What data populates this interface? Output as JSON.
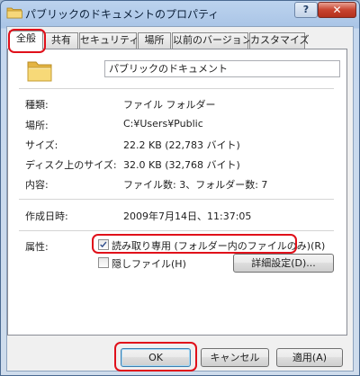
{
  "window": {
    "title": "パブリックのドキュメントのプロパティ"
  },
  "titlebar": {
    "help_label": "?",
    "close_label": "✕"
  },
  "tabs": [
    {
      "label": "全般",
      "active": true
    },
    {
      "label": "共有"
    },
    {
      "label": "セキュリティ"
    },
    {
      "label": "場所"
    },
    {
      "label": "以前のバージョン"
    },
    {
      "label": "カスタマイズ"
    }
  ],
  "general": {
    "folder_name": "パブリックのドキュメント",
    "fields": [
      {
        "label": "種類:",
        "value": "ファイル フォルダー"
      },
      {
        "label": "場所:",
        "value": "C:¥Users¥Public"
      },
      {
        "label": "サイズ:",
        "value": "22.2 KB (22,783 バイト)"
      },
      {
        "label": "ディスク上のサイズ:",
        "value": "32.0 KB (32,768 バイト)"
      },
      {
        "label": "内容:",
        "value": "ファイル数: 3、フォルダー数: 7"
      }
    ],
    "created": {
      "label": "作成日時:",
      "value": "2009年7月14日、11:37:05"
    },
    "attributes": {
      "label": "属性:",
      "readonly_label": "読み取り専用 (フォルダー内のファイルのみ)(R)",
      "readonly_checked": true,
      "hidden_label": "隠しファイル(H)",
      "hidden_checked": false,
      "advanced_label": "詳細設定(D)..."
    }
  },
  "footer": {
    "ok_label": "OK",
    "cancel_label": "キャンセル",
    "apply_label": "適用(A)"
  },
  "colors": {
    "highlight": "#e0101a",
    "folder": "#f2c95a"
  }
}
